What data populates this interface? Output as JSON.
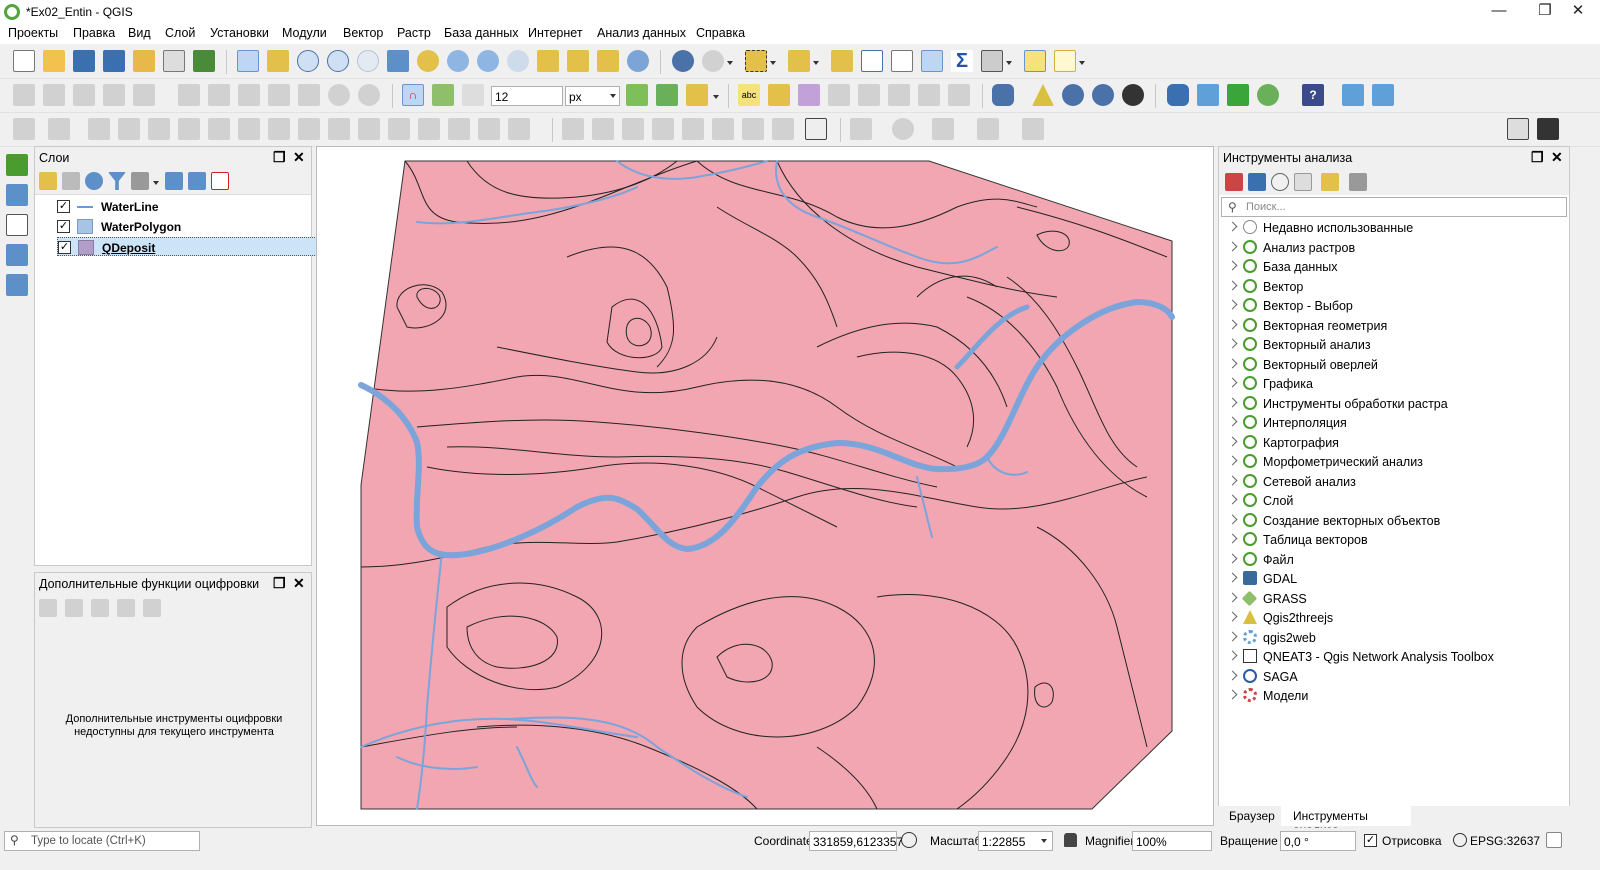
{
  "window": {
    "title": "*Ex02_Entin - QGIS",
    "minimize": "—",
    "restore": "❐",
    "close": "✕"
  },
  "menu": [
    "Проекты",
    "Правка",
    "Вид",
    "Слой",
    "Установки",
    "Модули",
    "Вектор",
    "Растр",
    "База данных",
    "Интернет",
    "Анализ данных",
    "Справка"
  ],
  "toolbar": {
    "snap_value": "12",
    "snap_unit": "px"
  },
  "layers_panel": {
    "title": "Слои",
    "layers": [
      {
        "name": "WaterLine",
        "checked": true,
        "symbol": "line",
        "color": "#6b9bd6"
      },
      {
        "name": "WaterPolygon",
        "checked": true,
        "symbol": "fill",
        "color": "#a7c4e4"
      },
      {
        "name": "QDeposit",
        "checked": true,
        "symbol": "fill",
        "color": "#b09ec9",
        "selected": true
      }
    ]
  },
  "digitize_panel": {
    "title": "Дополнительные функции оцифровки",
    "message": "Дополнительные инструменты оцифровки недоступны для текущего инструмента"
  },
  "processing_panel": {
    "title": "Инструменты анализа",
    "search_placeholder": "Поиск...",
    "items": [
      {
        "label": "Недавно использованные",
        "icon": "clock-icon"
      },
      {
        "label": "Анализ растров",
        "icon": "qgis-icon"
      },
      {
        "label": "База данных",
        "icon": "qgis-icon"
      },
      {
        "label": "Вектор",
        "icon": "qgis-icon"
      },
      {
        "label": "Вектор - Выбор",
        "icon": "qgis-icon"
      },
      {
        "label": "Векторная геометрия",
        "icon": "qgis-icon"
      },
      {
        "label": "Векторный анализ",
        "icon": "qgis-icon"
      },
      {
        "label": "Векторный оверлей",
        "icon": "qgis-icon"
      },
      {
        "label": "Графика",
        "icon": "qgis-icon"
      },
      {
        "label": "Инструменты обработки растра",
        "icon": "qgis-icon"
      },
      {
        "label": "Интерполяция",
        "icon": "qgis-icon"
      },
      {
        "label": "Картография",
        "icon": "qgis-icon"
      },
      {
        "label": "Морфометрический анализ",
        "icon": "qgis-icon"
      },
      {
        "label": "Сетевой анализ",
        "icon": "qgis-icon"
      },
      {
        "label": "Слой",
        "icon": "qgis-icon"
      },
      {
        "label": "Создание векторных объектов",
        "icon": "qgis-icon"
      },
      {
        "label": "Таблица векторов",
        "icon": "qgis-icon"
      },
      {
        "label": "Файл",
        "icon": "qgis-icon"
      },
      {
        "label": "GDAL",
        "icon": "gdal-icon"
      },
      {
        "label": "GRASS",
        "icon": "grass-icon"
      },
      {
        "label": "Qgis2threejs",
        "icon": "triangle-icon"
      },
      {
        "label": "qgis2web",
        "icon": "gear-icon"
      },
      {
        "label": "QNEAT3 - Qgis Network Analysis Toolbox",
        "icon": "qneat-icon"
      },
      {
        "label": "SAGA",
        "icon": "saga-icon"
      },
      {
        "label": "Модели",
        "icon": "models-icon"
      }
    ],
    "tabs": [
      "Браузер",
      "Инструменты анализа"
    ]
  },
  "map": {
    "deposit_fill": "#f2a6b2",
    "water_color": "#7ba4da"
  },
  "status": {
    "locator_placeholder": "Type to locate (Ctrl+K)",
    "coordinate_label": "Coordinate",
    "coordinate_value": "331859,6123357",
    "scale_label": "Масштаб",
    "scale_value": "1:22855",
    "magnifier_label": "Magnifier",
    "magnifier_value": "100%",
    "rotation_label": "Вращение",
    "rotation_value": "0,0 °",
    "render_label": "Отрисовка",
    "crs": "EPSG:32637"
  }
}
